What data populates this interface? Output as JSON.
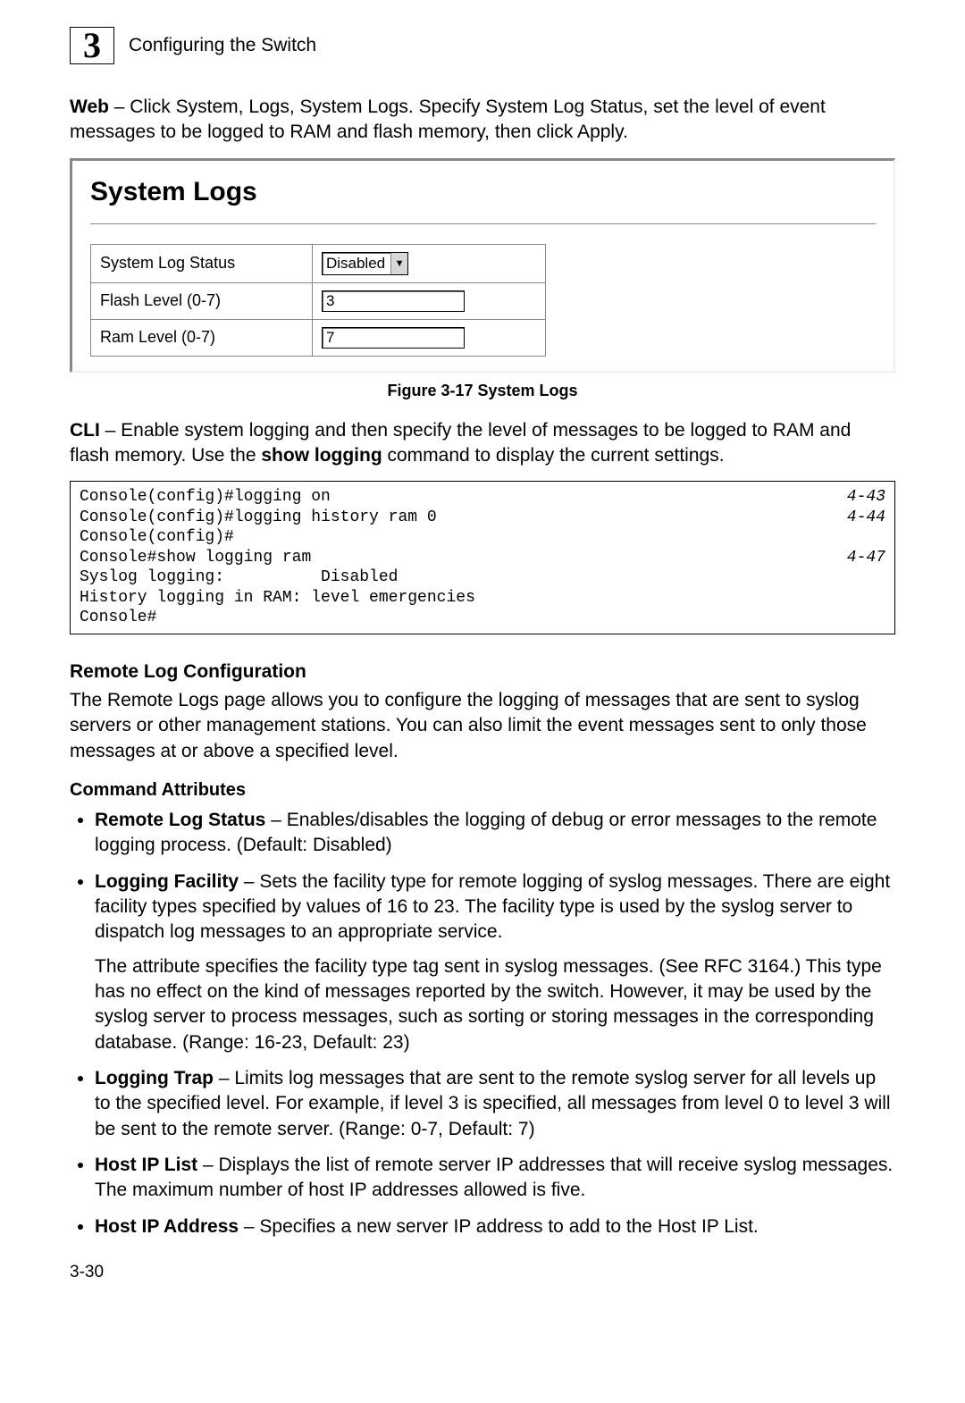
{
  "header": {
    "chapter_number": "3",
    "chapter_title": "Configuring the Switch"
  },
  "web_para": {
    "bold": "Web",
    "text": " – Click System, Logs, System Logs. Specify System Log Status, set the level of event messages to be logged to RAM and flash memory, then click Apply."
  },
  "screenshot": {
    "title": "System Logs",
    "rows": [
      {
        "label": "System Log Status",
        "type": "select",
        "value": "Disabled"
      },
      {
        "label": "Flash Level (0-7)",
        "type": "text",
        "value": "3"
      },
      {
        "label": "Ram Level (0-7)",
        "type": "text",
        "value": "7"
      }
    ]
  },
  "figure_caption": "Figure 3-17   System Logs",
  "cli_para": {
    "bold1": "CLI",
    "text1": " – Enable system logging and then specify the level of messages to be logged to RAM and flash memory. Use the ",
    "bold2": "show logging",
    "text2": " command to display the current settings."
  },
  "code": {
    "lines": [
      {
        "left": "Console(config)#logging on",
        "right": "4-43"
      },
      {
        "left": "Console(config)#logging history ram 0",
        "right": "4-44"
      },
      {
        "left": "Console(config)#",
        "right": ""
      },
      {
        "left": "Console#show logging ram",
        "right": "4-47"
      },
      {
        "left": "Syslog logging:          Disabled",
        "right": ""
      },
      {
        "left": "History logging in RAM: level emergencies",
        "right": ""
      },
      {
        "left": "Console#",
        "right": ""
      }
    ]
  },
  "remote": {
    "heading": "Remote Log Configuration",
    "intro": "The Remote Logs page allows you to configure the logging of messages that are sent to syslog servers or other management stations. You can also limit the event messages sent to only those messages at or above a specified level.",
    "cmd_attr_heading": "Command Attributes",
    "items": [
      {
        "bold": "Remote Log Status",
        "rest": " – Enables/disables the logging of debug or error messages to the remote logging process. (Default: Disabled)"
      },
      {
        "bold": "Logging Facility",
        "rest": " – Sets the facility type for remote logging of syslog messages. There are eight facility types specified by values of 16 to 23. The facility type is used by the syslog server to dispatch log messages to an appropriate service.",
        "sub": "The attribute specifies the facility type tag sent in syslog messages. (See RFC 3164.) This type has no effect on the kind of messages reported by the switch. However, it may be used by the syslog server to process messages, such as sorting or storing messages in the corresponding database. (Range: 16-23, Default: 23)"
      },
      {
        "bold": "Logging Trap",
        "rest": " – Limits log messages that are sent to the remote syslog server for all levels up to the specified level. For example, if level 3 is specified, all messages from level 0 to level 3 will be sent to the remote server. (Range: 0-7, Default: 7)"
      },
      {
        "bold": "Host IP List",
        "rest": " – Displays the list of remote server IP addresses that will receive syslog messages. The maximum number of host IP addresses allowed is five."
      },
      {
        "bold": "Host IP Address",
        "rest": " – Specifies a new server IP address to add to the Host IP List."
      }
    ]
  },
  "page_number": "3-30"
}
